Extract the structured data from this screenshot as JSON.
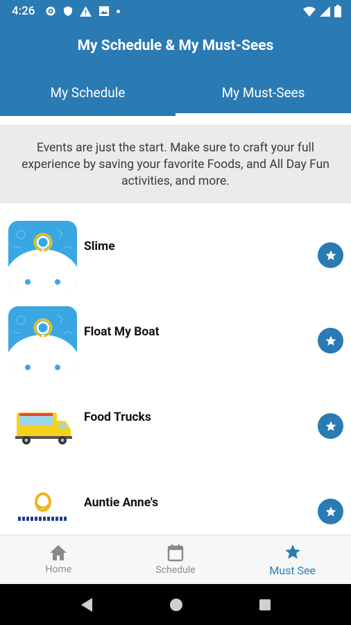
{
  "status_bar": {
    "time": "4:26"
  },
  "header": {
    "title": "My Schedule & My Must-Sees"
  },
  "tabs": [
    {
      "label": "My Schedule",
      "active": false
    },
    {
      "label": "My Must-Sees",
      "active": true
    }
  ],
  "banner": {
    "text": "Events are just the start. Make sure to craft your full experience by saving your favorite Foods, and All Day Fun activities, and more."
  },
  "items": [
    {
      "title": "Slime",
      "thumb": "fair-map-icon",
      "favorited": true
    },
    {
      "title": "Float My Boat",
      "thumb": "fair-map-icon",
      "favorited": true
    },
    {
      "title": "Food Trucks",
      "thumb": "food-truck-icon",
      "favorited": true
    },
    {
      "title": "Auntie Anne's",
      "thumb": "auntie-annes-logo",
      "favorited": true
    }
  ],
  "bottom_nav": [
    {
      "label": "Home",
      "icon": "home-icon",
      "active": false
    },
    {
      "label": "Schedule",
      "icon": "calendar-icon",
      "active": false
    },
    {
      "label": "Must See",
      "icon": "star-icon",
      "active": true
    }
  ],
  "colors": {
    "primary": "#2a7ab4",
    "thumb_bg": "#3aa7e2",
    "banner_bg": "#ebebeb"
  }
}
